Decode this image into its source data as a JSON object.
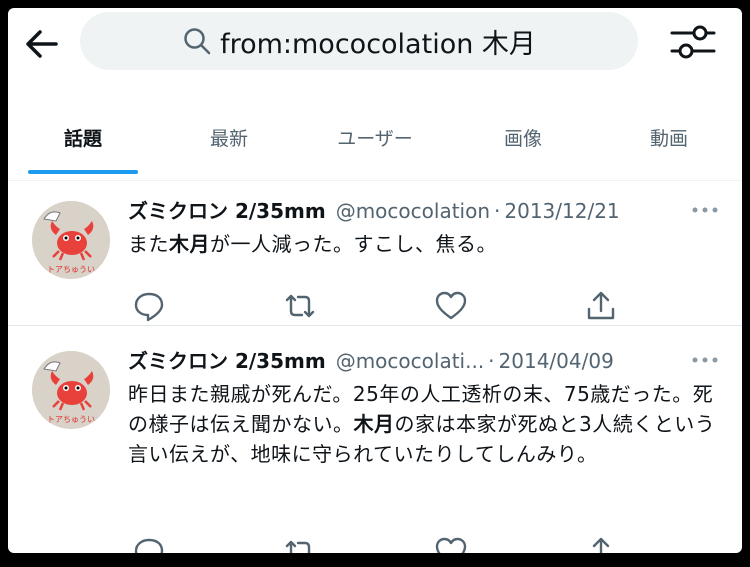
{
  "search": {
    "query": "from:mococolation 木月"
  },
  "tabs": [
    {
      "label": "話題",
      "active": true
    },
    {
      "label": "最新",
      "active": false
    },
    {
      "label": "ユーザー",
      "active": false
    },
    {
      "label": "画像",
      "active": false
    },
    {
      "label": "動画",
      "active": false
    }
  ],
  "tweets": [
    {
      "name": "ズミクロン 2/35mm",
      "handle": "@mococolation",
      "dot": "·",
      "date": "2013/12/21",
      "text_before": "また",
      "text_bold": "木月",
      "text_after": "が一人減った。すこし、焦る。",
      "avatar_label": "トアちゅうい"
    },
    {
      "name": "ズミクロン 2/35mm",
      "handle": "@mococolati...",
      "dot": "·",
      "date": "2014/04/09",
      "text_before": "昨日また親戚が死んだ。25年の人工透析の末、75歳だった。死の様子は伝え聞かない。",
      "text_bold": "木月",
      "text_after": "の家は本家が死ぬと3人続くという言い伝えが、地味に守られていたりしてしんみり。",
      "avatar_label": "トアちゅうい"
    }
  ],
  "colors": {
    "accent": "#1d9bf0",
    "secondary_text": "#536471",
    "crab": "#e8403a"
  }
}
